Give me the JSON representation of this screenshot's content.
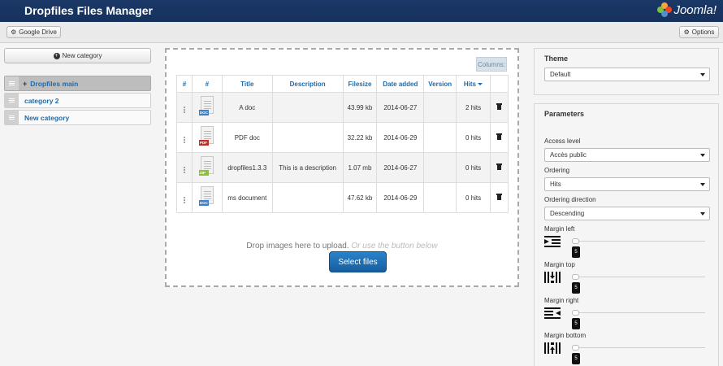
{
  "header": {
    "title": "Dropfiles Files Manager",
    "logo_text": "Joomla!"
  },
  "toolbar": {
    "google_drive": "Google Drive",
    "options": "Options"
  },
  "categories": {
    "new_label": "New category",
    "items": [
      {
        "label": "Dropfiles main"
      },
      {
        "label": "category 2"
      },
      {
        "label": "New category"
      }
    ]
  },
  "files": {
    "columns_button": "Columns:",
    "headers": [
      "#",
      "#",
      "Title",
      "Description",
      "Filesize",
      "Date added",
      "Version",
      "Hits"
    ],
    "rows": [
      {
        "type": "DOC",
        "title": "A doc",
        "description": "",
        "size": "43.99 kb",
        "date": "2014-06-27",
        "version": "",
        "hits": "2 hits"
      },
      {
        "type": "PDF",
        "title": "PDF doc",
        "description": "",
        "size": "32.22 kb",
        "date": "2014-06-29",
        "version": "",
        "hits": "0 hits"
      },
      {
        "type": "ZIP",
        "title": "dropfiles1.3.3",
        "description": "This is a description",
        "size": "1.07 mb",
        "date": "2014-06-27",
        "version": "",
        "hits": "0 hits"
      },
      {
        "type": "DOC",
        "title": "ms document",
        "description": "",
        "size": "47.62 kb",
        "date": "2014-06-29",
        "version": "",
        "hits": "0 hits"
      }
    ],
    "drop_text": "Drop images here to upload.",
    "drop_alt": "Or use the button below",
    "select_button": "Select files"
  },
  "theme": {
    "heading": "Theme",
    "value": "Default"
  },
  "parameters": {
    "heading": "Parameters",
    "access_label": "Access level",
    "access_value": "Accès public",
    "ordering_label": "Ordering",
    "ordering_value": "Hits",
    "direction_label": "Ordering direction",
    "direction_value": "Descending",
    "margins": [
      {
        "label": "Margin left",
        "value": "5"
      },
      {
        "label": "Margin top",
        "value": "5"
      },
      {
        "label": "Margin right",
        "value": "5"
      },
      {
        "label": "Margin bottom",
        "value": "5"
      }
    ]
  },
  "colors": {
    "header": "#1a3867",
    "link": "#1f6aa8",
    "button": "#2a82c9",
    "doc_tag": "#3b7fc4",
    "pdf_tag": "#c0302b",
    "zip_tag": "#8fbf3a"
  }
}
